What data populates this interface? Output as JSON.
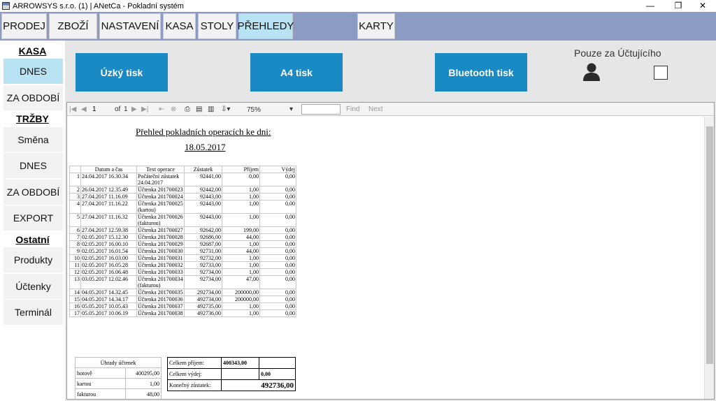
{
  "window": {
    "title": "ARROWSYS s.r.o. (1) | ANetCa - Pokladní systém",
    "controls": [
      "—",
      "❐",
      "✕"
    ]
  },
  "topnav": {
    "items": [
      {
        "label": "PRODEJ"
      },
      {
        "label": "ZBOŽÍ"
      },
      {
        "label": "NASTAVENÍ"
      },
      {
        "label": "KASA"
      },
      {
        "label": "STOLY"
      },
      {
        "label": "PŘEHLEDY"
      },
      {
        "label": "KARTY"
      }
    ],
    "active": "PŘEHLEDY",
    "bar_color": "#8b9bc4",
    "active_color": "#b8e3f3"
  },
  "sidebar": {
    "sections": [
      {
        "title": "KASA",
        "items": [
          "DNES",
          "ZA OBDOBÍ"
        ]
      },
      {
        "title": "TRŽBY",
        "items": [
          "Směna",
          "DNES",
          "ZA OBDOBÍ",
          "EXPORT"
        ]
      },
      {
        "title": "Ostatní",
        "items": [
          "Produkty",
          "Účtenky",
          "Terminál"
        ]
      }
    ],
    "active_item": "DNES"
  },
  "print_buttons": {
    "narrow": "Úzký tisk",
    "a4": "A4 tisk",
    "bluetooth": "Bluetooth tisk",
    "color": "#1a8ac4"
  },
  "uctujici": {
    "label": "Pouze za Účtujícího",
    "icon": "person-icon",
    "checked": false
  },
  "viewer_toolbar": {
    "page": "1",
    "of_label": "of",
    "total_pages": "1",
    "zoom": "75%",
    "find_value": "",
    "find_label": "Find",
    "next_label": "Next"
  },
  "report": {
    "title": "Přehled pokladních operacích ke dni:",
    "date": "18.05.2017",
    "columns": [
      "",
      "Datum a čas",
      "Text operace",
      "Zůstatek",
      "Příjem",
      "Výdej"
    ],
    "rows": [
      [
        "1",
        "24.04.2017 16.30.34",
        "Počáteční zůstatek 24.04.2017",
        "92441,00",
        "0,00",
        "0,00"
      ],
      [
        "2",
        "26.04.2017 12.35.49",
        "Účtenka 201700023",
        "92442,00",
        "1,00",
        "0,00"
      ],
      [
        "3",
        "27.04.2017 11.16.09",
        "Účtenka 201700024",
        "92443,00",
        "1,00",
        "0,00"
      ],
      [
        "4",
        "27.04.2017 11.16.22",
        "Účtenka 201700025 (kartou)",
        "92443,00",
        "1,00",
        "0,00"
      ],
      [
        "5",
        "27.04.2017 11.16.32",
        "Účtenka 201700026 (fakturou)",
        "92443,00",
        "1,00",
        "0,00"
      ],
      [
        "6",
        "27.04.2017 12.59.38",
        "Účtenka 201700027",
        "92642,00",
        "199,00",
        "0,00"
      ],
      [
        "7",
        "02.05.2017 15.12.30",
        "Účtenka 201700028",
        "92686,00",
        "44,00",
        "0,00"
      ],
      [
        "8",
        "02.05.2017 16.00.10",
        "Účtenka 201700029",
        "92687,00",
        "1,00",
        "0,00"
      ],
      [
        "9",
        "02.05.2017 16.01.54",
        "Účtenka 201700030",
        "92731,00",
        "44,00",
        "0,00"
      ],
      [
        "10",
        "02.05.2017 16.03.00",
        "Účtenka 201700031",
        "92732,00",
        "1,00",
        "0,00"
      ],
      [
        "11",
        "02.05.2017 16.05.28",
        "Účtenka 201700032",
        "92733,00",
        "1,00",
        "0,00"
      ],
      [
        "12",
        "02.05.2017 16.06.48",
        "Účtenka 201700033",
        "92734,00",
        "1,00",
        "0,00"
      ],
      [
        "13",
        "03.05.2017 12.02.46",
        "Účtenka 201700034 (fakturou)",
        "92734,00",
        "47,00",
        "0,00"
      ],
      [
        "14",
        "04.05.2017 14.32.45",
        "Účtenka 201700035",
        "292734,00",
        "200000,00",
        "0,00"
      ],
      [
        "15",
        "04.05.2017 14.34.17",
        "Účtenka 201700036",
        "492734,00",
        "200000,00",
        "0,00"
      ],
      [
        "16",
        "05.05.2017 10.05.43",
        "Účtenka 201700037",
        "492735,00",
        "1,00",
        "0,00"
      ],
      [
        "17",
        "05.05.2017 10.06.19",
        "Účtenka 201700038",
        "492736,00",
        "1,00",
        "0,00"
      ]
    ],
    "payments": {
      "title": "Úhrady účtenek",
      "rows": [
        [
          "hotově",
          "400295,00"
        ],
        [
          "kartou",
          "1,00"
        ],
        [
          "fakturou",
          "48,00"
        ]
      ]
    },
    "totals": {
      "income_label": "Celkem příjem:",
      "income": "400343,00",
      "expense_label": "Celkem výdej:",
      "expense": "0,00",
      "final_label": "Konečný zůstatek:",
      "final": "492736,00"
    }
  }
}
